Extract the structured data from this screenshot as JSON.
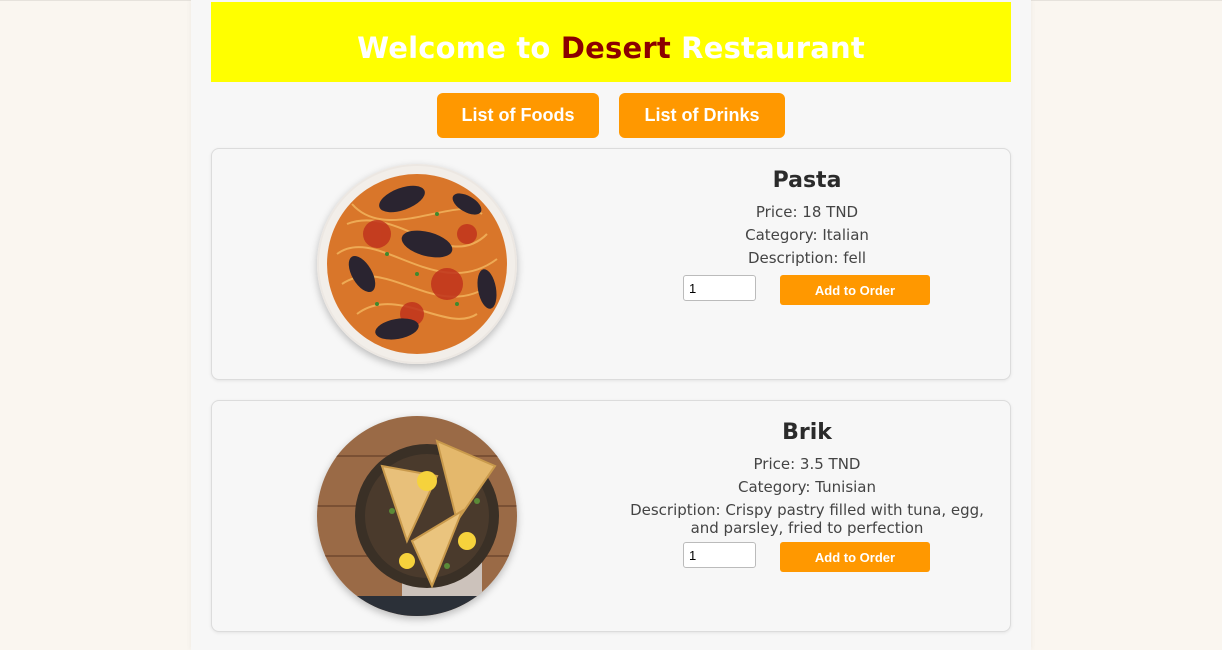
{
  "header": {
    "title_prefix": "Welcome to ",
    "title_brand": "Desert",
    "title_suffix": " Restaurant"
  },
  "nav": {
    "foods_label": "List of Foods",
    "drinks_label": "List of Drinks"
  },
  "items": [
    {
      "name": "Pasta",
      "price": "Price: 18 TND",
      "category": "Category: Italian",
      "description": "Description: fell",
      "quantity": "1",
      "button": "Add to Order",
      "image": "pasta-with-mussels-photo"
    },
    {
      "name": "Brik",
      "price": "Price: 3.5 TND",
      "category": "Category: Tunisian",
      "description": "Description: Crispy pastry filled with tuna, egg, and parsley, fried to perfection",
      "quantity": "1",
      "button": "Add to Order",
      "image": "brik-pastry-photo"
    }
  ],
  "colors": {
    "banner": "#ffff00",
    "brand": "#8b0000",
    "accent": "#ff9800"
  }
}
